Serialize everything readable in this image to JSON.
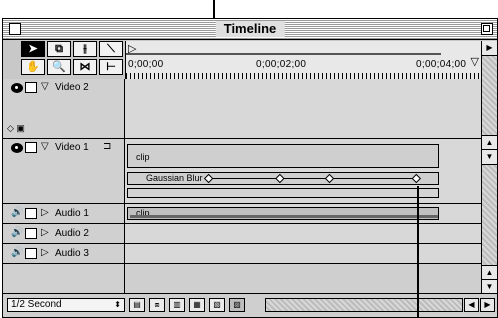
{
  "window": {
    "title": "Timeline"
  },
  "toolbox": {
    "tools": [
      {
        "name": "selection-tool",
        "glyph": "➤"
      },
      {
        "name": "track-select-tool",
        "glyph": "⧉"
      },
      {
        "name": "ripple-edit-tool",
        "glyph": "⫲"
      },
      {
        "name": "razor-tool",
        "glyph": "⟍"
      },
      {
        "name": "hand-tool",
        "glyph": "✋"
      },
      {
        "name": "zoom-tool",
        "glyph": "🔍"
      },
      {
        "name": "link-tool",
        "glyph": "⋈"
      },
      {
        "name": "in-out-tool",
        "glyph": "⊢"
      }
    ]
  },
  "ruler": {
    "work_area_start": "▷",
    "edit_line_marker": "▽",
    "labels": [
      "0;00;00",
      "0;00;02;00",
      "0;00;04;00"
    ]
  },
  "tracks": {
    "video2": {
      "label": "Video 2",
      "twirl": "▽"
    },
    "video1": {
      "label": "Video 1",
      "twirl": "▽",
      "clip_label": "clip",
      "effect_label": "Gaussian Blur",
      "keyframes": [
        0.26,
        0.49,
        0.65,
        0.93
      ]
    },
    "audio1": {
      "label": "Audio 1",
      "twirl": "▷",
      "clip_label": "clip"
    },
    "audio2": {
      "label": "Audio 2",
      "twirl": "▷"
    },
    "audio3": {
      "label": "Audio 3",
      "twirl": "▷"
    }
  },
  "status_bar": {
    "time_unit": "1/2 Second",
    "time_unit_arrow": "⬍",
    "buttons": [
      "▤",
      "⧈",
      "▥",
      "▦",
      "▧",
      "▨"
    ],
    "scroll_left": "◀",
    "scroll_right": "▶"
  },
  "scrollbar": {
    "up": "▲",
    "down": "▼",
    "right": "▶"
  },
  "colors": {
    "background": "#c8c8c8",
    "track": "#d8d8d8",
    "clip": "#cfcfcf"
  }
}
